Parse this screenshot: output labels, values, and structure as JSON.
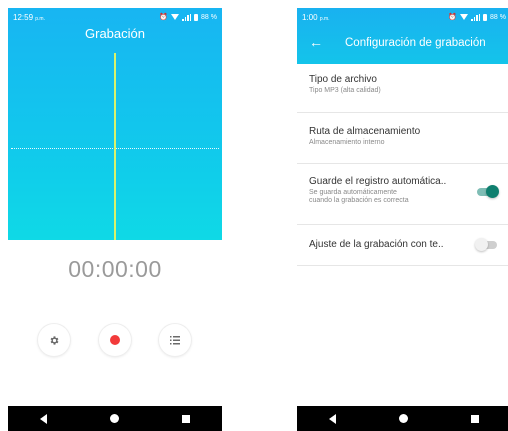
{
  "left_phone": {
    "status": {
      "time": "12:59",
      "time_suffix": "p.m.",
      "battery": "88 %"
    },
    "title": "Grabación",
    "timer": "00:00:00",
    "buttons": {
      "settings_icon": "gear-icon",
      "record_icon": "record-icon",
      "list_icon": "list-icon"
    },
    "colors": {
      "gradient_top": "#18b5f2",
      "gradient_bottom": "#0fd9e6",
      "playhead": "#d8f36a",
      "record": "#f23a3a"
    }
  },
  "right_phone": {
    "status": {
      "time": "1:00",
      "time_suffix": "p.m.",
      "battery": "88 %"
    },
    "header": {
      "back_icon": "arrow-left-icon",
      "title": "Configuración de grabación"
    },
    "settings": [
      {
        "title": "Tipo de archivo",
        "subtitle": "Tipo MP3 (alta calidad)"
      },
      {
        "title": "Ruta de almacenamiento",
        "subtitle": "Almacenamiento interno"
      },
      {
        "title": "Guarde el registro automática..",
        "subtitle_line1": "Se guarda automáticamente",
        "subtitle_line2": "cuando la grabación es correcta",
        "toggle": "on"
      },
      {
        "title": "Ajuste de la grabación con te..",
        "toggle": "off"
      }
    ],
    "colors": {
      "toggle_on": "#0f7f6f",
      "toggle_off": "#cfcfcf"
    }
  },
  "nav": {
    "back_icon": "nav-back-icon",
    "home_icon": "nav-home-icon",
    "recent_icon": "nav-recent-icon"
  }
}
